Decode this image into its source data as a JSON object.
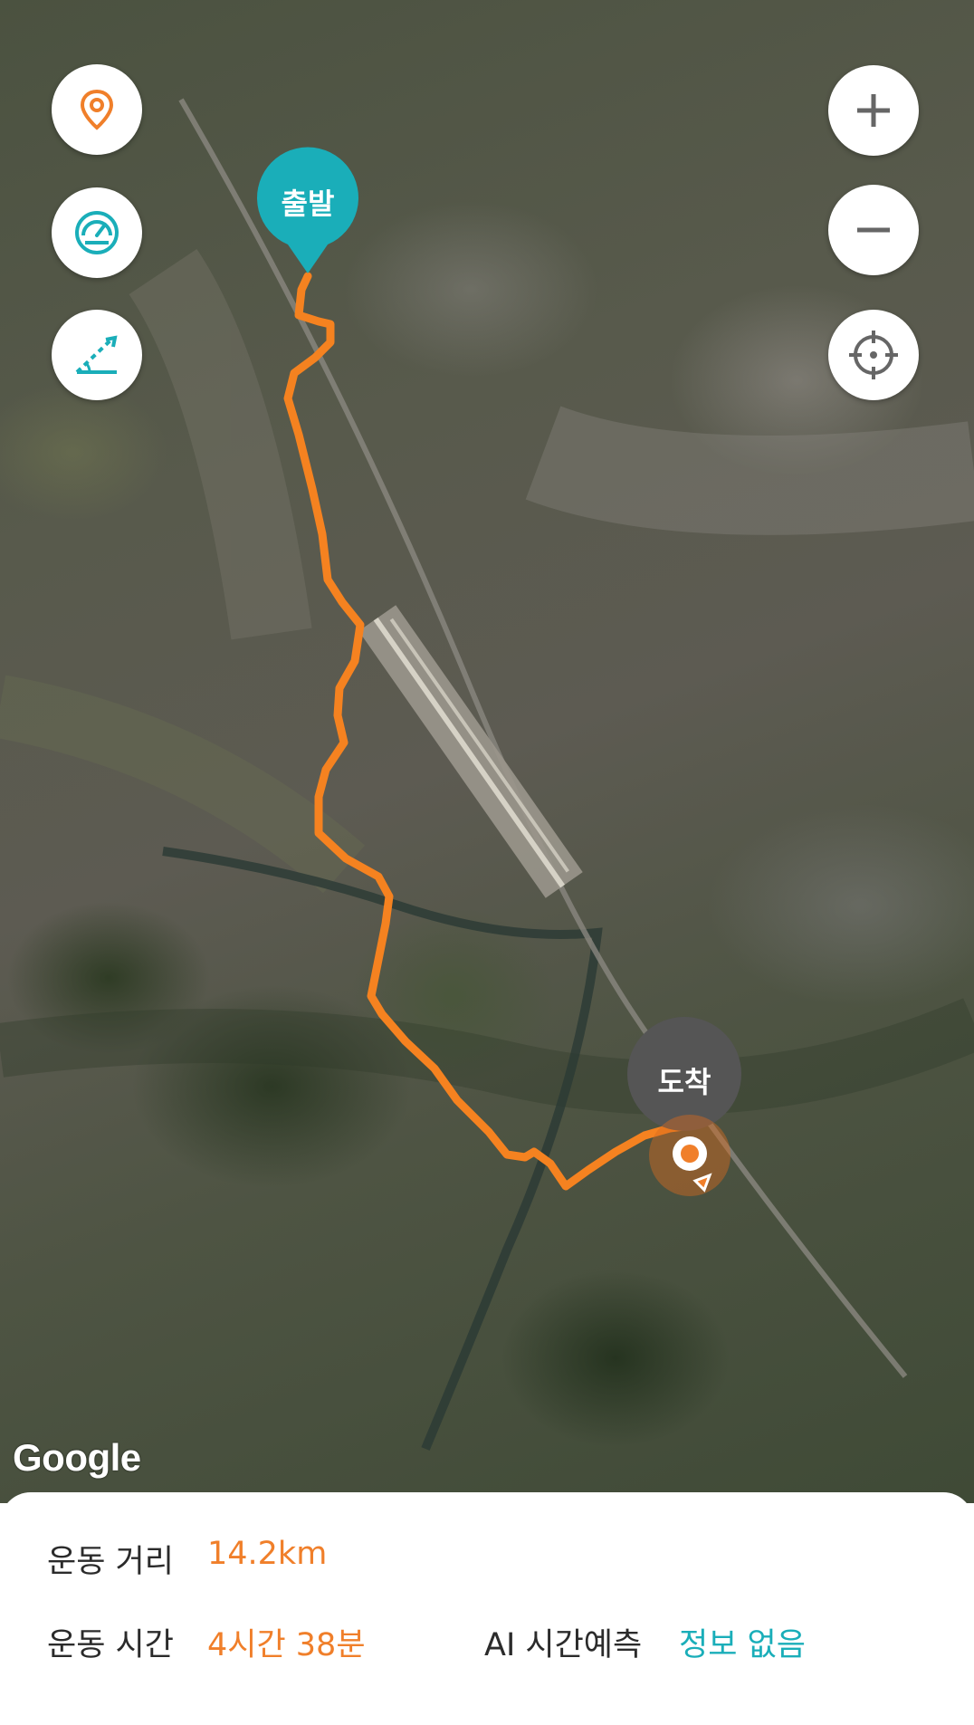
{
  "map": {
    "start_label": "출발",
    "end_label": "도착",
    "attribution": "Google",
    "colors": {
      "route": "#f58220",
      "start_marker": "#1aaeb9",
      "end_marker": "#555555"
    }
  },
  "controls": {
    "left": [
      {
        "name": "location-pin-icon",
        "color": "#f07f2a"
      },
      {
        "name": "speedometer-icon",
        "color": "#1aaeb9"
      },
      {
        "name": "slope-icon",
        "color": "#1aaeb9"
      }
    ],
    "right": [
      {
        "name": "zoom-in-icon"
      },
      {
        "name": "zoom-out-icon"
      },
      {
        "name": "crosshair-icon"
      }
    ]
  },
  "stats": {
    "distance_label": "운동 거리",
    "distance_value": "14.2km",
    "time_label": "운동 시간",
    "time_value": "4시간 38분",
    "ai_label": "AI 시간예측",
    "ai_value": "정보 없음"
  }
}
